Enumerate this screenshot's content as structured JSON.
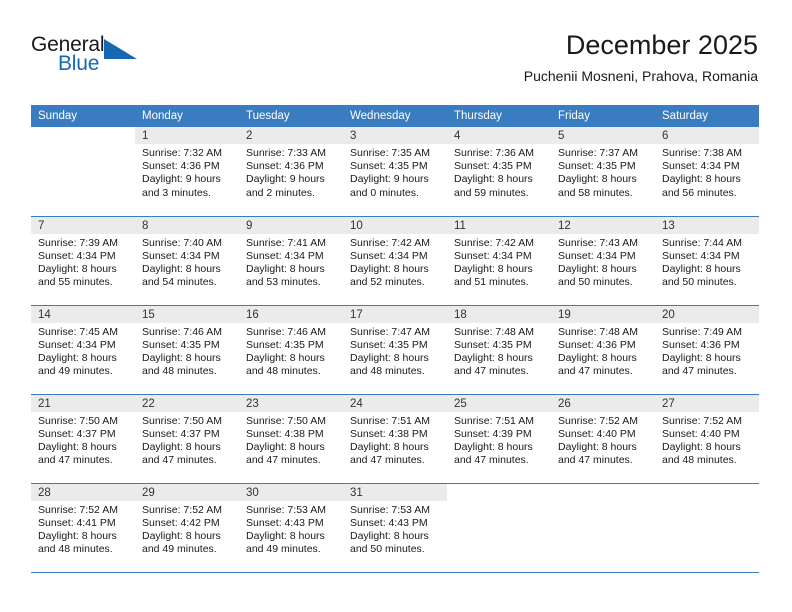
{
  "brand": {
    "name_part1": "General",
    "name_part2": "Blue",
    "accent_color": "#1668b4",
    "triangle_icon": "triangle-icon"
  },
  "header": {
    "title": "December 2025",
    "subtitle": "Puchenii Mosneni, Prahova, Romania"
  },
  "calendar": {
    "header_bg": "#3a7cc0",
    "daynum_bg": "#ebebeb",
    "weekday_headers": [
      "Sunday",
      "Monday",
      "Tuesday",
      "Wednesday",
      "Thursday",
      "Friday",
      "Saturday"
    ],
    "weeks": [
      [
        {
          "day": "",
          "lines": []
        },
        {
          "day": "1",
          "lines": [
            "Sunrise: 7:32 AM",
            "Sunset: 4:36 PM",
            "Daylight: 9 hours",
            "and 3 minutes."
          ]
        },
        {
          "day": "2",
          "lines": [
            "Sunrise: 7:33 AM",
            "Sunset: 4:36 PM",
            "Daylight: 9 hours",
            "and 2 minutes."
          ]
        },
        {
          "day": "3",
          "lines": [
            "Sunrise: 7:35 AM",
            "Sunset: 4:35 PM",
            "Daylight: 9 hours",
            "and 0 minutes."
          ]
        },
        {
          "day": "4",
          "lines": [
            "Sunrise: 7:36 AM",
            "Sunset: 4:35 PM",
            "Daylight: 8 hours",
            "and 59 minutes."
          ]
        },
        {
          "day": "5",
          "lines": [
            "Sunrise: 7:37 AM",
            "Sunset: 4:35 PM",
            "Daylight: 8 hours",
            "and 58 minutes."
          ]
        },
        {
          "day": "6",
          "lines": [
            "Sunrise: 7:38 AM",
            "Sunset: 4:34 PM",
            "Daylight: 8 hours",
            "and 56 minutes."
          ]
        }
      ],
      [
        {
          "day": "7",
          "lines": [
            "Sunrise: 7:39 AM",
            "Sunset: 4:34 PM",
            "Daylight: 8 hours",
            "and 55 minutes."
          ]
        },
        {
          "day": "8",
          "lines": [
            "Sunrise: 7:40 AM",
            "Sunset: 4:34 PM",
            "Daylight: 8 hours",
            "and 54 minutes."
          ]
        },
        {
          "day": "9",
          "lines": [
            "Sunrise: 7:41 AM",
            "Sunset: 4:34 PM",
            "Daylight: 8 hours",
            "and 53 minutes."
          ]
        },
        {
          "day": "10",
          "lines": [
            "Sunrise: 7:42 AM",
            "Sunset: 4:34 PM",
            "Daylight: 8 hours",
            "and 52 minutes."
          ]
        },
        {
          "day": "11",
          "lines": [
            "Sunrise: 7:42 AM",
            "Sunset: 4:34 PM",
            "Daylight: 8 hours",
            "and 51 minutes."
          ]
        },
        {
          "day": "12",
          "lines": [
            "Sunrise: 7:43 AM",
            "Sunset: 4:34 PM",
            "Daylight: 8 hours",
            "and 50 minutes."
          ]
        },
        {
          "day": "13",
          "lines": [
            "Sunrise: 7:44 AM",
            "Sunset: 4:34 PM",
            "Daylight: 8 hours",
            "and 50 minutes."
          ]
        }
      ],
      [
        {
          "day": "14",
          "lines": [
            "Sunrise: 7:45 AM",
            "Sunset: 4:34 PM",
            "Daylight: 8 hours",
            "and 49 minutes."
          ]
        },
        {
          "day": "15",
          "lines": [
            "Sunrise: 7:46 AM",
            "Sunset: 4:35 PM",
            "Daylight: 8 hours",
            "and 48 minutes."
          ]
        },
        {
          "day": "16",
          "lines": [
            "Sunrise: 7:46 AM",
            "Sunset: 4:35 PM",
            "Daylight: 8 hours",
            "and 48 minutes."
          ]
        },
        {
          "day": "17",
          "lines": [
            "Sunrise: 7:47 AM",
            "Sunset: 4:35 PM",
            "Daylight: 8 hours",
            "and 48 minutes."
          ]
        },
        {
          "day": "18",
          "lines": [
            "Sunrise: 7:48 AM",
            "Sunset: 4:35 PM",
            "Daylight: 8 hours",
            "and 47 minutes."
          ]
        },
        {
          "day": "19",
          "lines": [
            "Sunrise: 7:48 AM",
            "Sunset: 4:36 PM",
            "Daylight: 8 hours",
            "and 47 minutes."
          ]
        },
        {
          "day": "20",
          "lines": [
            "Sunrise: 7:49 AM",
            "Sunset: 4:36 PM",
            "Daylight: 8 hours",
            "and 47 minutes."
          ]
        }
      ],
      [
        {
          "day": "21",
          "lines": [
            "Sunrise: 7:50 AM",
            "Sunset: 4:37 PM",
            "Daylight: 8 hours",
            "and 47 minutes."
          ]
        },
        {
          "day": "22",
          "lines": [
            "Sunrise: 7:50 AM",
            "Sunset: 4:37 PM",
            "Daylight: 8 hours",
            "and 47 minutes."
          ]
        },
        {
          "day": "23",
          "lines": [
            "Sunrise: 7:50 AM",
            "Sunset: 4:38 PM",
            "Daylight: 8 hours",
            "and 47 minutes."
          ]
        },
        {
          "day": "24",
          "lines": [
            "Sunrise: 7:51 AM",
            "Sunset: 4:38 PM",
            "Daylight: 8 hours",
            "and 47 minutes."
          ]
        },
        {
          "day": "25",
          "lines": [
            "Sunrise: 7:51 AM",
            "Sunset: 4:39 PM",
            "Daylight: 8 hours",
            "and 47 minutes."
          ]
        },
        {
          "day": "26",
          "lines": [
            "Sunrise: 7:52 AM",
            "Sunset: 4:40 PM",
            "Daylight: 8 hours",
            "and 47 minutes."
          ]
        },
        {
          "day": "27",
          "lines": [
            "Sunrise: 7:52 AM",
            "Sunset: 4:40 PM",
            "Daylight: 8 hours",
            "and 48 minutes."
          ]
        }
      ],
      [
        {
          "day": "28",
          "lines": [
            "Sunrise: 7:52 AM",
            "Sunset: 4:41 PM",
            "Daylight: 8 hours",
            "and 48 minutes."
          ]
        },
        {
          "day": "29",
          "lines": [
            "Sunrise: 7:52 AM",
            "Sunset: 4:42 PM",
            "Daylight: 8 hours",
            "and 49 minutes."
          ]
        },
        {
          "day": "30",
          "lines": [
            "Sunrise: 7:53 AM",
            "Sunset: 4:43 PM",
            "Daylight: 8 hours",
            "and 49 minutes."
          ]
        },
        {
          "day": "31",
          "lines": [
            "Sunrise: 7:53 AM",
            "Sunset: 4:43 PM",
            "Daylight: 8 hours",
            "and 50 minutes."
          ]
        },
        {
          "day": "",
          "lines": []
        },
        {
          "day": "",
          "lines": []
        },
        {
          "day": "",
          "lines": []
        }
      ]
    ]
  }
}
